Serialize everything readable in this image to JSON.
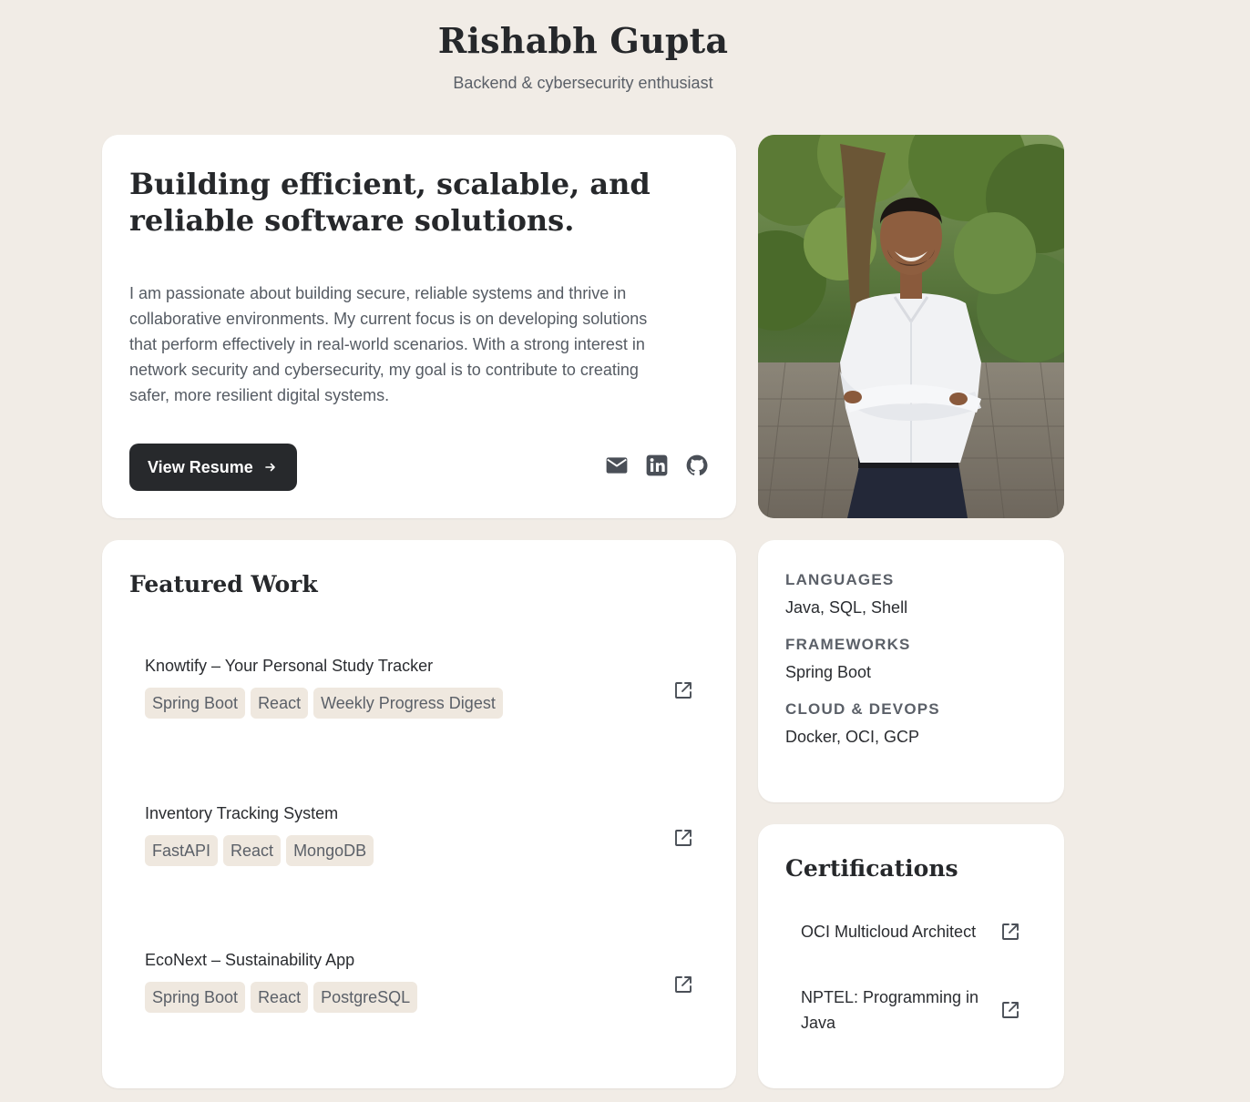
{
  "header": {
    "name": "Rishabh Gupta",
    "tagline": "Backend & cybersecurity enthusiast"
  },
  "hero": {
    "headline": "Building efficient, scalable, and reliable software solutions.",
    "bio": "I am passionate about building secure, reliable systems and thrive in collaborative environments. My current focus is on developing solutions that perform effectively in real-world scenarios. With a strong interest in network security and cybersecurity, my goal is to contribute to creating safer, more resilient digital systems.",
    "resume_button": "View Resume",
    "resume_icon": "arrow-right-icon",
    "social_icons": [
      "mail-icon",
      "linkedin-icon",
      "github-icon"
    ]
  },
  "featured_work": {
    "heading": "Featured Work",
    "projects": [
      {
        "title": "Knowtify – Your Personal Study Tracker",
        "tags": [
          "Spring Boot",
          "React",
          "Weekly Progress Digest"
        ]
      },
      {
        "title": "Inventory Tracking System",
        "tags": [
          "FastAPI",
          "React",
          "MongoDB"
        ]
      },
      {
        "title": "EcoNext – Sustainability App",
        "tags": [
          "Spring Boot",
          "React",
          "PostgreSQL"
        ]
      }
    ]
  },
  "skills": {
    "groups": [
      {
        "label": "LANGUAGES",
        "value": "Java, SQL, Shell"
      },
      {
        "label": "FRAMEWORKS",
        "value": "Spring Boot"
      },
      {
        "label": "CLOUD & DEVOPS",
        "value": "Docker, OCI, GCP"
      }
    ]
  },
  "certifications": {
    "heading": "Certifications",
    "items": [
      {
        "label": "OCI Multicloud Architect"
      },
      {
        "label": "NPTEL: Programming in Java"
      }
    ]
  },
  "colors": {
    "background": "#f1ece6",
    "card": "#ffffff",
    "primary_button": "#27292c",
    "tag_background": "#efe8df",
    "muted_text": "#5b6068"
  }
}
